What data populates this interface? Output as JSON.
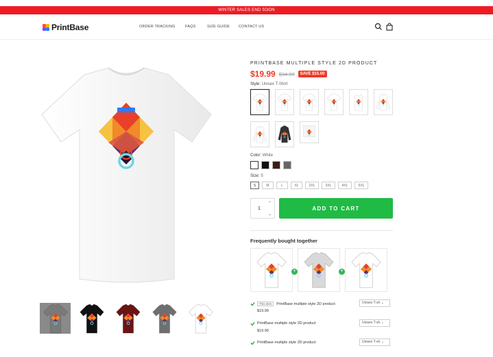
{
  "banner": {
    "text": "WINTER SALES END SOON"
  },
  "header": {
    "logo_text": "PrintBase",
    "nav": [
      "ORDER TRACKING",
      "FAQS",
      "SIZE GUIDE",
      "CONTACT US"
    ]
  },
  "product": {
    "title": "PRINTBASE MULTIPLE STYLE 2D PRODUCT",
    "price": "$19.99",
    "compare_price": "$34.99",
    "save_badge": "SAVE $15.00",
    "style_label": "Style:",
    "style_value": "Unisex T-Shirt",
    "color_label": "Color:",
    "color_value": "White",
    "size_label": "Size:",
    "size_value": "S",
    "sizes": [
      "S",
      "M",
      "L",
      "XL",
      "2XL",
      "3XL",
      "4XL",
      "5XL"
    ],
    "colors": [
      "#ffffff",
      "#111111",
      "#3a1d14",
      "#666666"
    ],
    "quantity": "1",
    "add_to_cart": "ADD TO CART",
    "thumb_colors": [
      "#7a7a7a",
      "#111111",
      "#6b1414",
      "#6f6f6f",
      "#ffffff"
    ]
  },
  "fbt": {
    "title": "Frequently bought together",
    "items": [
      {
        "tag": "This item",
        "name": "PrintBase multiple style 2D product",
        "price": "$19.99",
        "variant": "Unisex T-sh"
      },
      {
        "tag": "",
        "name": "PrintBase multiple style 2D product",
        "price": "$19.99",
        "variant": "Unisex T-sh"
      },
      {
        "tag": "",
        "name": "PrintBase multiple style 2D product",
        "price": "",
        "variant": "Unisex T-sh"
      }
    ]
  },
  "colors": {
    "banner": "#ee1b24",
    "price": "#ee3a24",
    "cta": "#20bb44"
  }
}
